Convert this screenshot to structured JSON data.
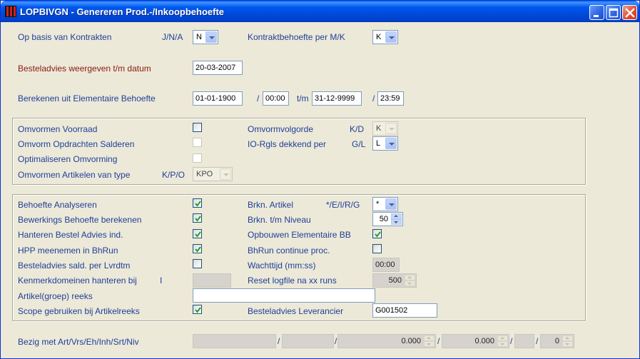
{
  "window": {
    "title": "LOPBIVGN - Genereren Prod.-/Inkoopbehoefte"
  },
  "top": {
    "kontrakten_label": "Op basis van Kontrakten",
    "kontrakten_hint": "J/N/A",
    "kontrakten_value": "N",
    "kontraktbehoefte_label": "Kontraktbehoefte per M/K",
    "kontraktbehoefte_value": "K",
    "besteladvies_label": "Besteladvies weergeven t/m datum",
    "besteladvies_date": "20-03-2007",
    "berekenen_label": "Berekenen uit Elementaire Behoefte",
    "from_date": "01-01-1900",
    "from_time": "00:00",
    "tm_label": "t/m",
    "to_date": "31-12-9999",
    "to_time": "23:59",
    "slash": "/"
  },
  "group1": {
    "voorraad_label": "Omvormen Voorraad",
    "opdrachten_label": "Omvorm Opdrachten Salderen",
    "optimaliseren_label": "Optimaliseren Omvorming",
    "artikelen_label": "Omvormen Artikelen van type",
    "artikelen_hint": "K/P/O",
    "artikelen_value": "KPO",
    "volgorde_label": "Omvormvolgorde",
    "volgorde_hint": "K/D",
    "volgorde_value": "K",
    "iorgls_label": "IO-Rgls dekkend per",
    "iorgls_hint": "G/L",
    "iorgls_value": "L"
  },
  "group2": {
    "analyseren_label": "Behoefte Analyseren",
    "bewerkings_label": "Bewerkings Behoefte berekenen",
    "hanteren_label": "Hanteren Bestel Advies ind.",
    "hpp_label": "HPP meenemen in BhRun",
    "sald_label": "Besteladvies sald. per Lvrdtm",
    "kenmerk_label": "Kenmerkdomeinen hanteren bij",
    "kenmerk_hint": "I",
    "reeks_label": "Artikel(groep) reeks",
    "scope_label": "Scope gebruiken bij Artikelreeks",
    "brkn_artikel_label": "Brkn. Artikel",
    "brkn_artikel_hint": "*/E/I/R/G",
    "brkn_artikel_value": "*",
    "brkn_niveau_label": "Brkn. t/m Niveau",
    "brkn_niveau_value": "50",
    "opbouwen_label": "Opbouwen Elementaire BB",
    "continue_label": "BhRun continue proc.",
    "wachttijd_label": "Wachttijd (mm:ss)",
    "wachttijd_value": "00:00",
    "reset_label": "Reset logfile na xx runs",
    "reset_value": "500",
    "leverancier_label": "Besteladvies Leverancier",
    "leverancier_value": "G001502"
  },
  "bottom": {
    "bezig_label": "Bezig met Art/Vrs/Eh/Inh/Srt/Niv",
    "val1": "0.000",
    "val2": "0.000",
    "val3": "0"
  }
}
